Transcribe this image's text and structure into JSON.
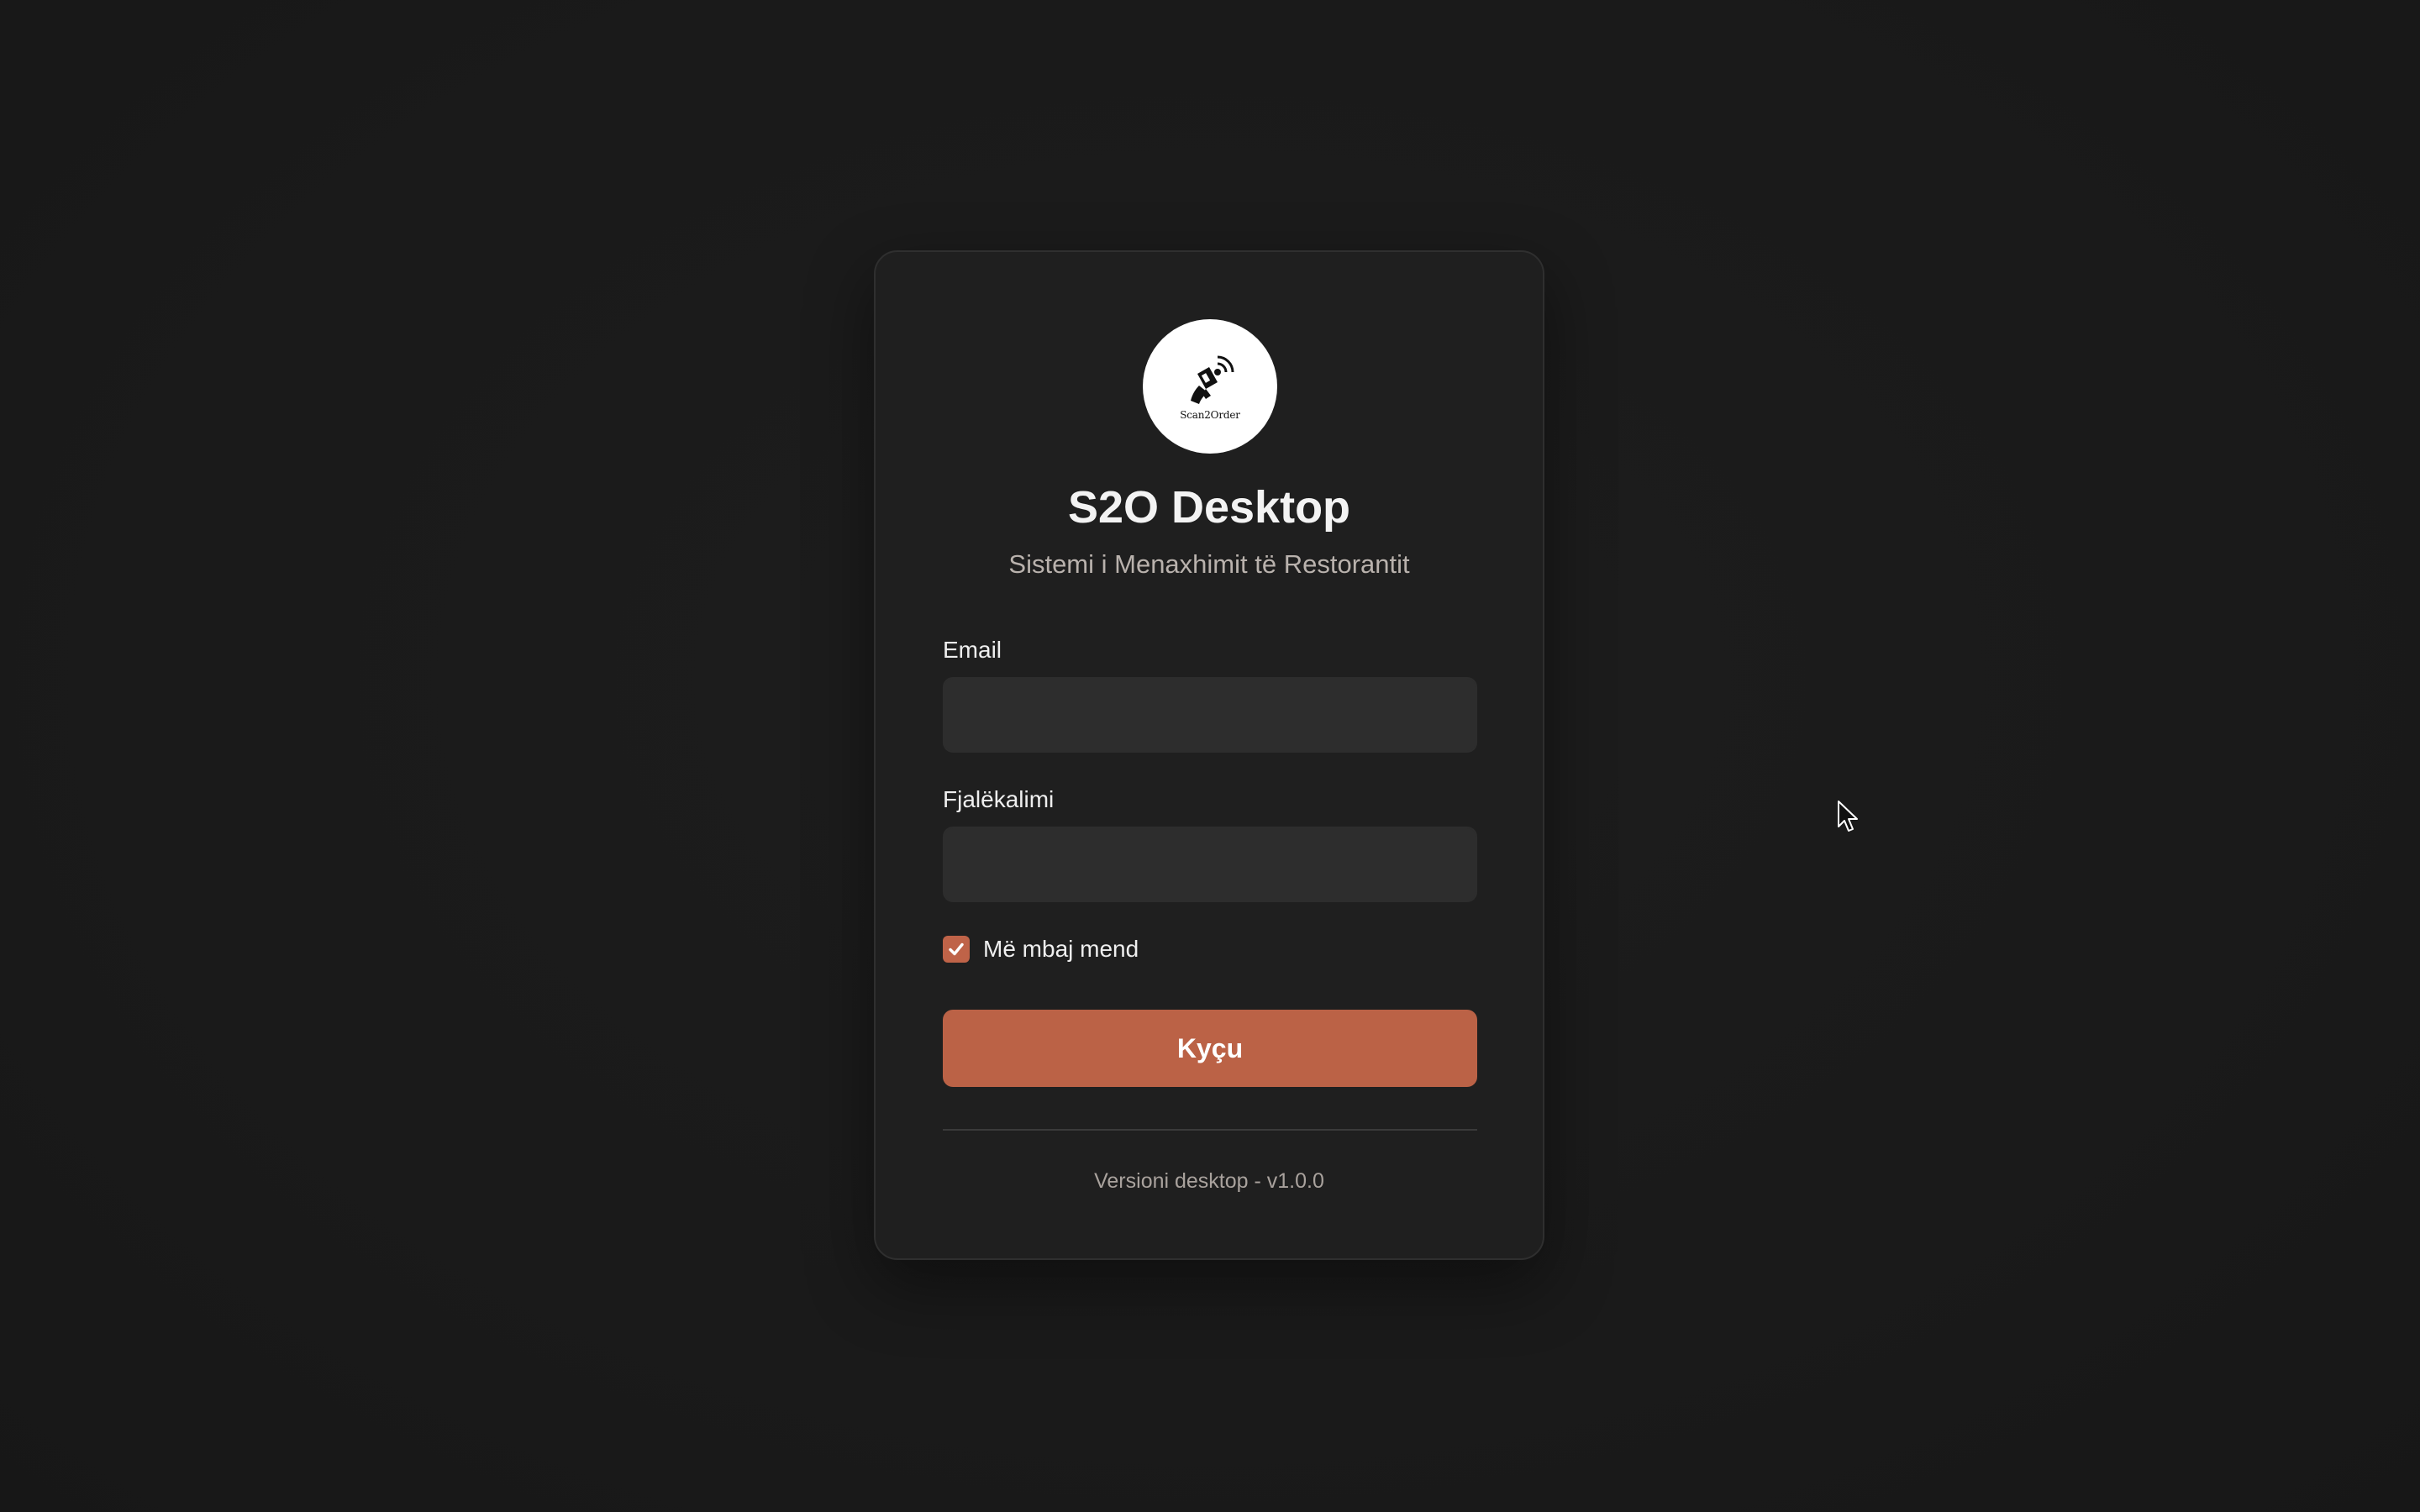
{
  "app": {
    "logo_text": "Scan2Order",
    "title": "S2O Desktop",
    "subtitle": "Sistemi i Menaxhimit të Restorantit"
  },
  "form": {
    "email_label": "Email",
    "email_value": "",
    "password_label": "Fjalëkalimi",
    "password_value": "",
    "remember_label": "Më mbaj mend",
    "remember_checked": true,
    "submit_label": "Kyçu"
  },
  "footer": {
    "version_text": "Versioni desktop - v1.0.0"
  },
  "colors": {
    "accent": "#bb6246",
    "card_background": "#1f1f1f",
    "page_background": "#1b1b1b",
    "input_background": "#2d2d2d"
  },
  "icons": {
    "logo": "phone-tap-icon",
    "checkbox": "checkmark-icon",
    "pointer": "mouse-cursor-icon"
  }
}
